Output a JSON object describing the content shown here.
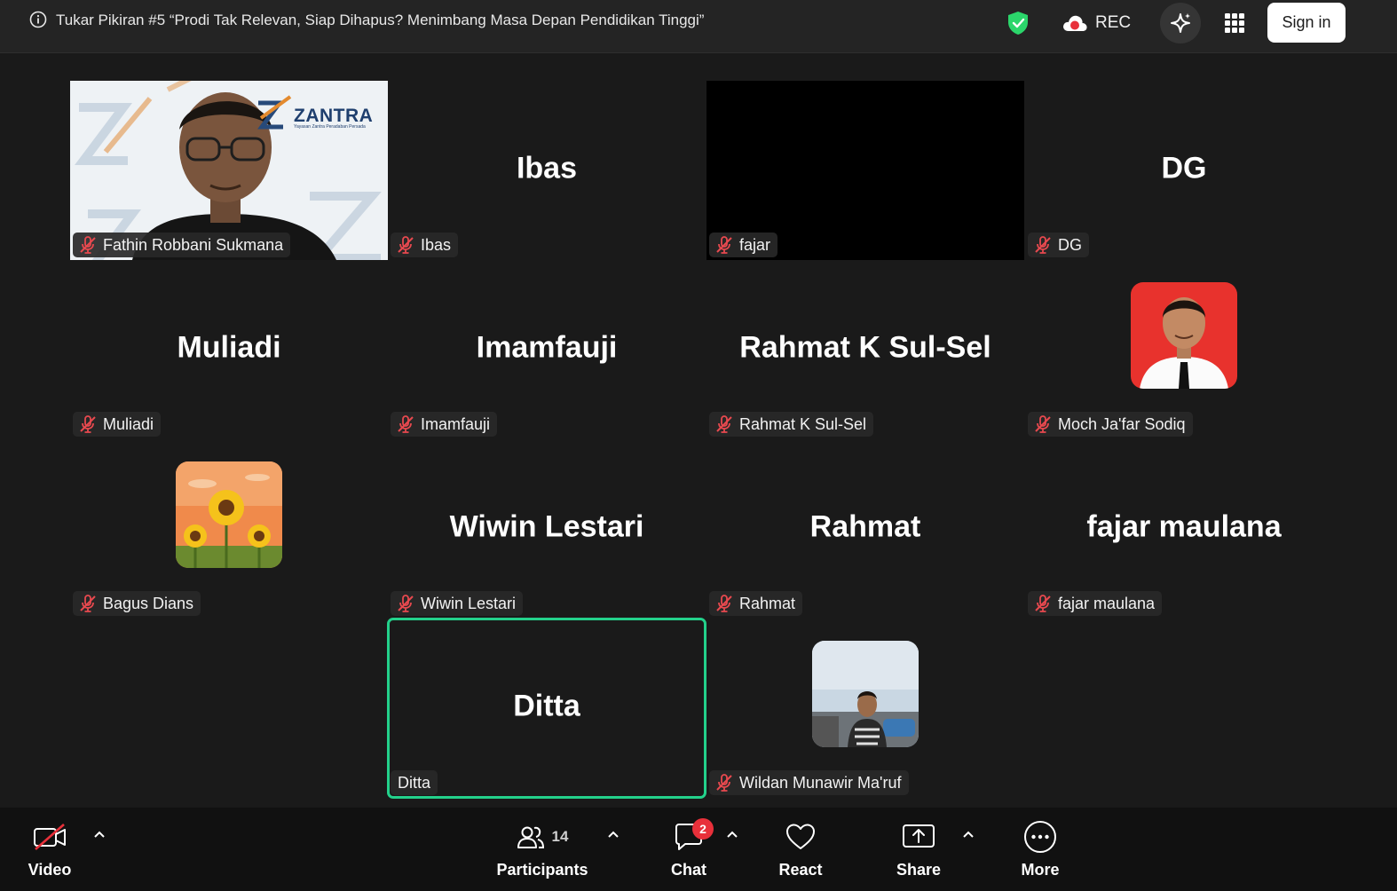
{
  "meeting": {
    "title": "Tukar Pikiran #5 “Prodi Tak Relevan, Siap Dihapus? Menimbang Masa Depan Pendidikan Tinggi”",
    "rec_label": "REC",
    "signin_label": "Sign in"
  },
  "tiles": [
    {
      "name": "Fathin Robbani Sukmana",
      "big": "",
      "type": "video",
      "logo_text": "ZANTRA",
      "logo_sub": "Yayasan Zantra Peradaban Persada"
    },
    {
      "name": "Ibas",
      "big": "Ibas",
      "type": "name"
    },
    {
      "name": "fajar",
      "big": "",
      "type": "black"
    },
    {
      "name": "DG",
      "big": "DG",
      "type": "name"
    },
    {
      "name": "Muliadi",
      "big": "Muliadi",
      "type": "name"
    },
    {
      "name": "Imamfauji",
      "big": "Imamfauji",
      "type": "name"
    },
    {
      "name": "Rahmat K Sul-Sel",
      "big": "Rahmat K Sul-Sel",
      "type": "name"
    },
    {
      "name": "Moch Ja'far Sodiq",
      "big": "",
      "type": "avatar"
    },
    {
      "name": "Bagus Dians",
      "big": "",
      "type": "avatar"
    },
    {
      "name": "Wiwin Lestari",
      "big": "Wiwin Lestari",
      "type": "name"
    },
    {
      "name": "Rahmat",
      "big": "Rahmat",
      "type": "name"
    },
    {
      "name": "fajar maulana",
      "big": "fajar maulana",
      "type": "name"
    },
    {
      "name": "Ditta",
      "big": "Ditta",
      "type": "name",
      "active": true
    },
    {
      "name": "Wildan Munawir Ma'ruf",
      "big": "",
      "type": "avatar"
    }
  ],
  "toolbar": {
    "video_label": "Video",
    "participants_label": "Participants",
    "participants_count": "14",
    "chat_label": "Chat",
    "chat_badge": "2",
    "react_label": "React",
    "share_label": "Share",
    "more_label": "More"
  },
  "colors": {
    "background": "#1a1a1a",
    "active_speaker": "#23d18b",
    "muted_mic": "#e8494f",
    "shield": "#2bd66b",
    "rec_dot": "#e8303a"
  }
}
